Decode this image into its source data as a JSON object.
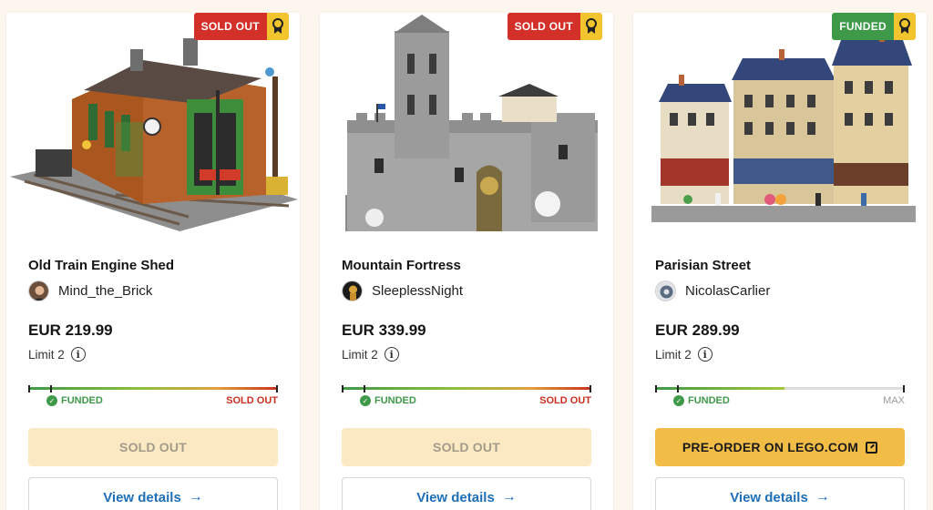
{
  "cards": [
    {
      "badge": "SOLD OUT",
      "badge_color": "#d4302a",
      "award_icon": "award-ribbon-icon",
      "title": "Old Train Engine Shed",
      "creator": "Mind_the_Brick",
      "price": "EUR 219.99",
      "limit": "Limit 2",
      "progress": {
        "funded_fraction": 0.09,
        "fill_fraction": 1.0,
        "funded_label": "FUNDED",
        "end_label": "SOLD OUT"
      },
      "action_label": "SOLD OUT",
      "action_state": "disabled",
      "details_label": "View details"
    },
    {
      "badge": "SOLD OUT",
      "badge_color": "#d4302a",
      "award_icon": "award-ribbon-icon",
      "title": "Mountain Fortress",
      "creator": "SleeplessNight",
      "price": "EUR 339.99",
      "limit": "Limit 2",
      "progress": {
        "funded_fraction": 0.09,
        "fill_fraction": 1.0,
        "funded_label": "FUNDED",
        "end_label": "SOLD OUT"
      },
      "action_label": "SOLD OUT",
      "action_state": "disabled",
      "details_label": "View details"
    },
    {
      "badge": "FUNDED",
      "badge_color": "#3e9a48",
      "award_icon": "award-ribbon-icon",
      "title": "Parisian Street",
      "creator": "NicolasCarlier",
      "price": "EUR 289.99",
      "limit": "Limit 2",
      "progress": {
        "funded_fraction": 0.09,
        "fill_fraction": 0.52,
        "funded_label": "FUNDED",
        "end_label": "MAX"
      },
      "action_label": "PRE-ORDER ON LEGO.COM",
      "action_state": "active",
      "details_label": "View details"
    }
  ],
  "colors": {
    "background": "#fdf6ee",
    "funded_green": "#3e9a48",
    "sold_out_red": "#c9311f",
    "preorder_yellow": "#f2bd46",
    "link_blue": "#1e6fb8"
  }
}
